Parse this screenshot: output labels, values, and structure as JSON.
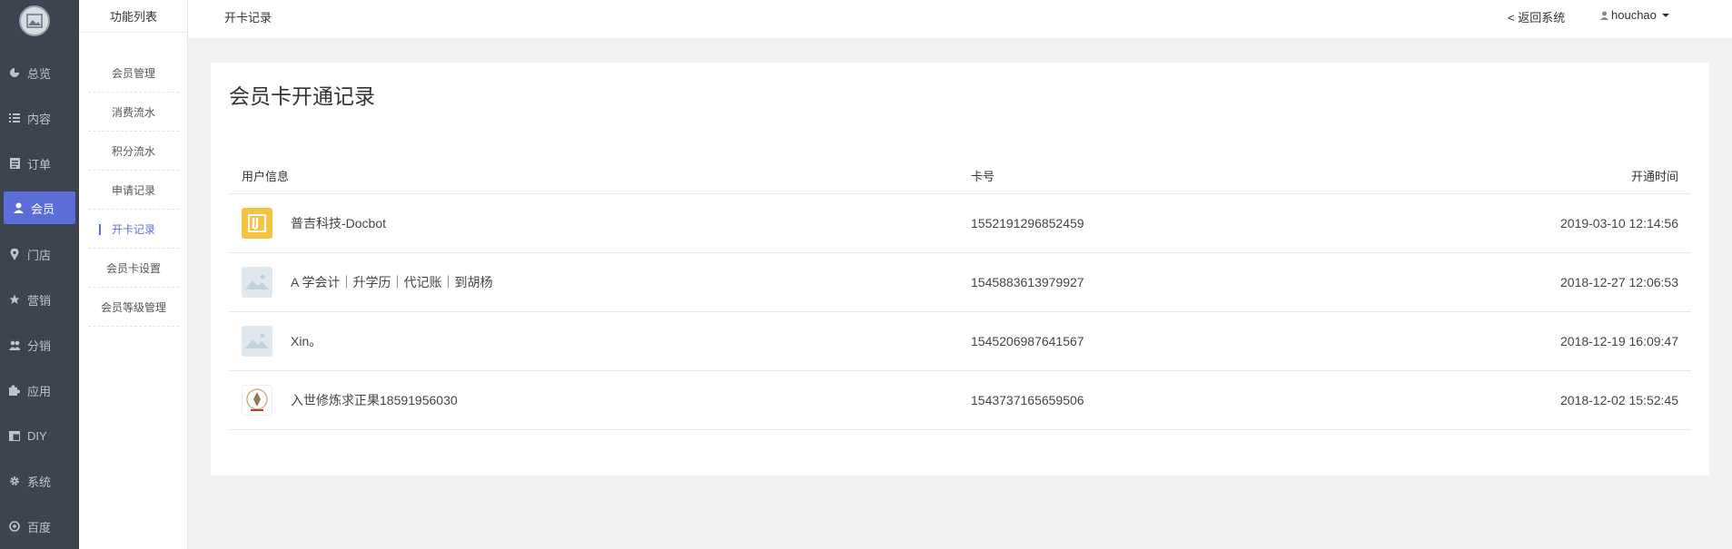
{
  "mainnav": {
    "items": [
      {
        "label": "总览",
        "icon": "pie-chart-icon"
      },
      {
        "label": "内容",
        "icon": "list-icon"
      },
      {
        "label": "订单",
        "icon": "clipboard-icon"
      },
      {
        "label": "会员",
        "icon": "user-icon",
        "active": true
      },
      {
        "label": "门店",
        "icon": "map-pin-icon"
      },
      {
        "label": "营销",
        "icon": "star-icon"
      },
      {
        "label": "分销",
        "icon": "users-icon"
      },
      {
        "label": "应用",
        "icon": "puzzle-icon"
      },
      {
        "label": "DIY",
        "icon": "layout-icon"
      },
      {
        "label": "系统",
        "icon": "gear-icon"
      },
      {
        "label": "百度",
        "icon": "baidu-icon"
      }
    ]
  },
  "subnav": {
    "title": "功能列表",
    "items": [
      {
        "label": "会员管理"
      },
      {
        "label": "消费流水"
      },
      {
        "label": "积分流水"
      },
      {
        "label": "申请记录"
      },
      {
        "label": "开卡记录",
        "active": true
      },
      {
        "label": "会员卡设置"
      },
      {
        "label": "会员等级管理"
      }
    ]
  },
  "header": {
    "breadcrumb": "开卡记录",
    "back_label": "< 返回系统",
    "username": "houchao"
  },
  "panel": {
    "title": "会员卡开通记录",
    "columns": {
      "user": "用户信息",
      "card": "卡号",
      "time": "开通时间"
    },
    "rows": [
      {
        "name": "普吉科技-Docbot",
        "card": "1552191296852459",
        "time": "2019-03-10 12:14:56",
        "avatar": "yellow-logo-icon"
      },
      {
        "name": "A 学会计｜升学历｜代记账｜到胡杨",
        "card": "1545883613979927",
        "time": "2018-12-27 12:06:53",
        "avatar": "image-placeholder-icon"
      },
      {
        "name": "Xin。",
        "card": "1545206987641567",
        "time": "2018-12-19 16:09:47",
        "avatar": "image-placeholder-icon"
      },
      {
        "name": "入世修炼求正果18591956030",
        "card": "1543737165659506",
        "time": "2018-12-02 15:52:45",
        "avatar": "seal-logo-icon"
      }
    ]
  },
  "colors": {
    "accent": "#5a6dd8",
    "sidebar": "#3e444f",
    "avatar_yellow": "#f5c242"
  }
}
